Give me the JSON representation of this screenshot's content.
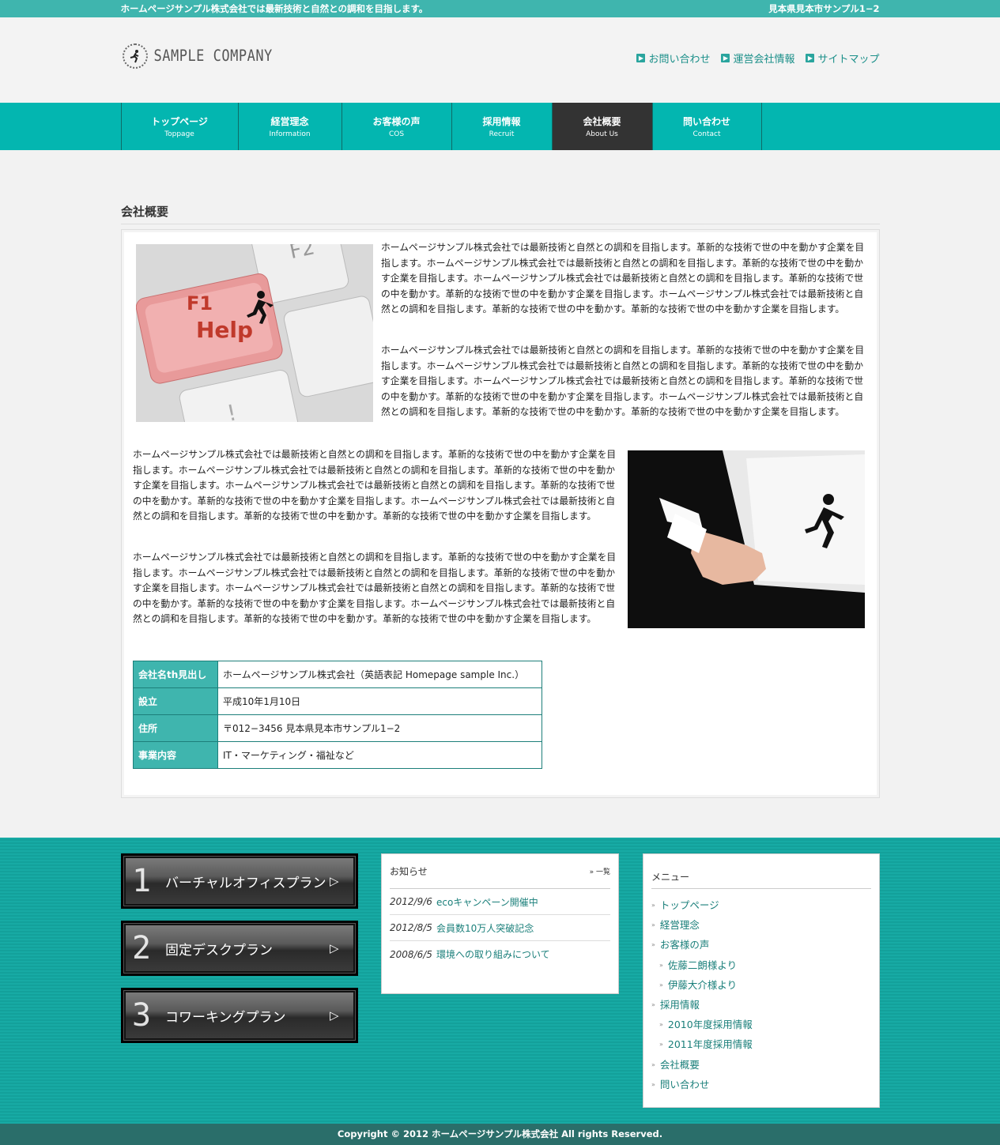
{
  "topbar": {
    "tagline": "ホームページサンプル株式会社では最新技術と自然との調和を目指します。",
    "address": "見本県見本市サンプル1−2"
  },
  "header": {
    "logo_text": "SAMPLE COMPANY",
    "links": [
      {
        "label": "お問い合わせ"
      },
      {
        "label": "運営会社情報"
      },
      {
        "label": "サイトマップ"
      }
    ]
  },
  "nav": [
    {
      "jp": "トップページ",
      "en": "Toppage"
    },
    {
      "jp": "経営理念",
      "en": "Information"
    },
    {
      "jp": "お客様の声",
      "en": "COS"
    },
    {
      "jp": "採用情報",
      "en": "Recruit"
    },
    {
      "jp": "会社概要",
      "en": "About Us"
    },
    {
      "jp": "問い合わせ",
      "en": "Contact"
    }
  ],
  "main": {
    "title": "会社概要",
    "para": "ホームページサンプル株式会社では最新技術と自然との調和を目指します。革新的な技術で世の中を動かす企業を目指します。ホームページサンプル株式会社では最新技術と自然との調和を目指します。革新的な技術で世の中を動かす企業を目指します。ホームページサンプル株式会社では最新技術と自然との調和を目指します。革新的な技術で世の中を動かす。革新的な技術で世の中を動かす企業を目指します。ホームページサンプル株式会社では最新技術と自然との調和を目指します。革新的な技術で世の中を動かす。革新的な技術で世の中を動かす企業を目指します。",
    "image1_text": "F1 Help",
    "table": [
      {
        "th": "会社名th見出し",
        "td": "ホームページサンプル株式会社（英語表記 Homepage sample Inc.）"
      },
      {
        "th": "設立",
        "td": "平成10年1月10日"
      },
      {
        "th": "住所",
        "td": "〒012−3456 見本県見本市サンプル1−2"
      },
      {
        "th": "事業内容",
        "td": "IT・マーケティング・福祉など"
      }
    ]
  },
  "plans": [
    {
      "num": "1",
      "label": "バーチャルオフィスプラン"
    },
    {
      "num": "2",
      "label": "固定デスクプラン"
    },
    {
      "num": "3",
      "label": "コワーキングプラン"
    }
  ],
  "news": {
    "title": "お知らせ",
    "more": "一覧",
    "items": [
      {
        "date": "2012/9/6",
        "title": "ecoキャンペーン開催中"
      },
      {
        "date": "2012/8/5",
        "title": "会員数10万人突破記念"
      },
      {
        "date": "2008/6/5",
        "title": "環境への取り組みについて"
      }
    ]
  },
  "menu": {
    "title": "メニュー",
    "items": [
      {
        "label": "トップページ"
      },
      {
        "label": "経営理念"
      },
      {
        "label": "お客様の声"
      },
      {
        "label": "佐藤二朗様より"
      },
      {
        "label": "伊藤大介様より"
      },
      {
        "label": "採用情報"
      },
      {
        "label": "2010年度採用情報"
      },
      {
        "label": "2011年度採用情報"
      },
      {
        "label": "会社概要"
      },
      {
        "label": "問い合わせ"
      }
    ]
  },
  "footer": {
    "copyright": "Copyright © 2012 ホームページサンプル株式会社 All rights Reserved."
  },
  "colors": {
    "accent": "#03b6b0",
    "topbar": "#3fb5ae",
    "active_nav": "#333333",
    "footer_band": "#2a6e6a"
  }
}
